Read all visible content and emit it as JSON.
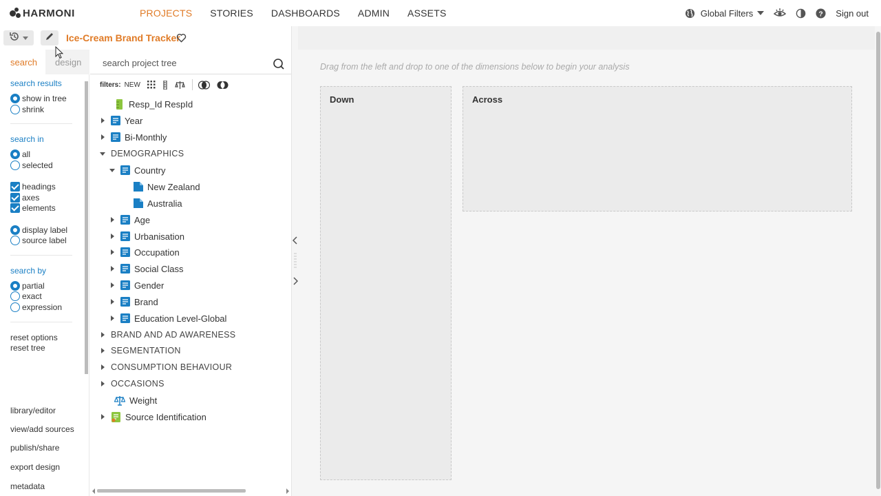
{
  "brand": {
    "name": "HARMONI"
  },
  "nav": [
    {
      "label": "PROJECTS",
      "active": true
    },
    {
      "label": "STORIES",
      "active": false
    },
    {
      "label": "DASHBOARDS",
      "active": false
    },
    {
      "label": "ADMIN",
      "active": false
    },
    {
      "label": "ASSETS",
      "active": false
    }
  ],
  "top_right": {
    "global_filters_label": "Global Filters",
    "sign_out_label": "Sign out"
  },
  "toolbar": {
    "project_title": "Ice-Cream Brand Tracker"
  },
  "left_panel": {
    "tabs": {
      "search": "search",
      "design": "design"
    },
    "search_results": {
      "title": "search results",
      "show_in_tree": "show in tree",
      "shrink": "shrink"
    },
    "search_in": {
      "title": "search in",
      "all": "all",
      "selected": "selected",
      "headings": "headings",
      "axes": "axes",
      "elements": "elements",
      "display_label": "display label",
      "source_label": "source label"
    },
    "search_by": {
      "title": "search by",
      "partial": "partial",
      "exact": "exact",
      "expression": "expression"
    },
    "reset_options": "reset options",
    "reset_tree": "reset tree",
    "bottom_links": {
      "library_editor": "library/editor",
      "view_add_sources": "view/add sources",
      "publish_share": "publish/share",
      "export_design": "export design",
      "metadata": "metadata"
    }
  },
  "tree_panel": {
    "search_placeholder": "search project tree",
    "filters_label": "filters:",
    "filters_new": "NEW",
    "nodes": [
      {
        "label": "Resp_Id RespId"
      },
      {
        "label": "Year"
      },
      {
        "label": "Bi-Monthly"
      },
      {
        "label": "DEMOGRAPHICS"
      },
      {
        "label": "Country"
      },
      {
        "label": "New Zealand"
      },
      {
        "label": "Australia"
      },
      {
        "label": "Age"
      },
      {
        "label": "Urbanisation"
      },
      {
        "label": "Occupation"
      },
      {
        "label": "Social Class"
      },
      {
        "label": "Gender"
      },
      {
        "label": "Brand"
      },
      {
        "label": "Education Level-Global"
      },
      {
        "label": "BRAND AND AD AWARENESS"
      },
      {
        "label": "SEGMENTATION"
      },
      {
        "label": "CONSUMPTION BEHAVIOUR"
      },
      {
        "label": "OCCASIONS"
      },
      {
        "label": "Weight"
      },
      {
        "label": "Source Identification"
      }
    ]
  },
  "main": {
    "hint": "Drag from the left and drop to one of the dimensions below to begin your analysis",
    "down_label": "Down",
    "across_label": "Across"
  },
  "colors": {
    "accent": "#e07b27",
    "blue": "#1a7fc4",
    "green": "#8dc63f"
  }
}
